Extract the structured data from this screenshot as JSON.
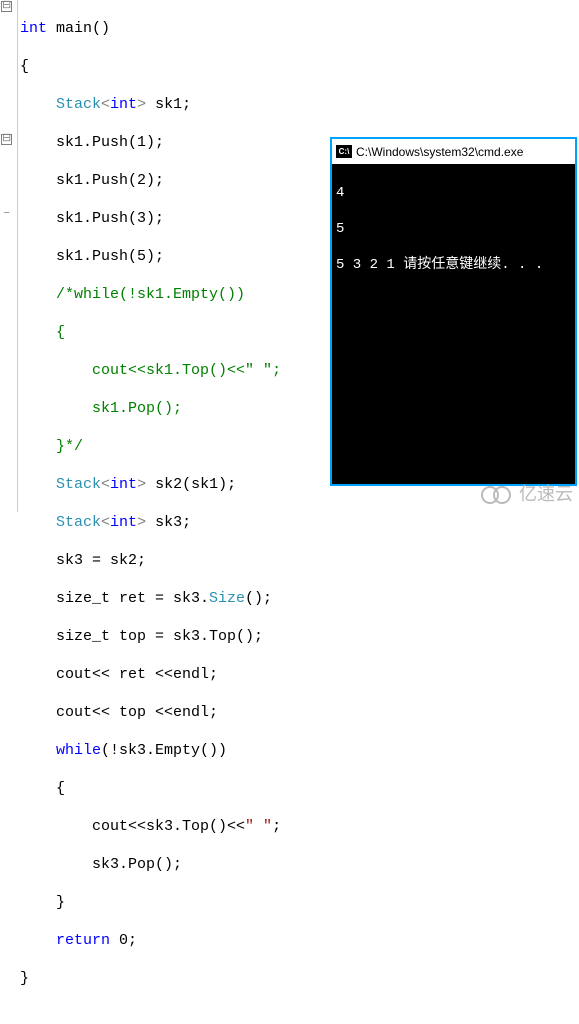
{
  "code": {
    "l1_kw": "int",
    "l1_rest": " main()",
    "l2": "{",
    "l3a": "    ",
    "l3_cls": "Stack",
    "l3_lt": "<",
    "l3_typ": "int",
    "l3_gt": ">",
    "l3_rest": " sk1;",
    "l4": "    sk1.Push(1);",
    "l5": "    sk1.Push(2);",
    "l6": "    sk1.Push(3);",
    "l7": "    sk1.Push(5);",
    "l8": "    /*while(!sk1.Empty())",
    "l9": "    {",
    "l10a": "        cout<<sk1.Top()<<",
    "l10_str": "\" \"",
    "l10b": ";",
    "l11": "        sk1.Pop();",
    "l12": "    }*/",
    "l13a": "    ",
    "l13_cls": "Stack",
    "l13_lt": "<",
    "l13_typ": "int",
    "l13_gt": ">",
    "l13_rest": " sk2(sk1);",
    "l14a": "    ",
    "l14_cls": "Stack",
    "l14_lt": "<",
    "l14_typ": "int",
    "l14_gt": ">",
    "l14_rest": " sk3;",
    "l15": "    sk3 = sk2;",
    "l16a": "    size_t ret = sk3.",
    "l16_cls": "Size",
    "l16b": "();",
    "l17": "    size_t top = sk3.Top();",
    "l18": "    cout<< ret <<endl;",
    "l19": "    cout<< top <<endl;",
    "l20a": "    ",
    "l20_kw": "while",
    "l20_rest": "(!sk3.Empty())",
    "l21": "    {",
    "l22a": "        cout<<sk3.Top()<<",
    "l22_str": "\" \"",
    "l22b": ";",
    "l23": "        sk3.Pop();",
    "l24": "    }",
    "l25a": "    ",
    "l25_kw": "return",
    "l25_rest": " 0;",
    "l26": "}"
  },
  "gutter": {
    "minus": "⊟",
    "dash": "−"
  },
  "console": {
    "icon": "C:\\",
    "title": " C:\\Windows\\system32\\cmd.exe",
    "line1": "4",
    "line2": "5",
    "line3": "5 3 2 1 请按任意键继续. . ."
  },
  "watermark": "亿速云"
}
